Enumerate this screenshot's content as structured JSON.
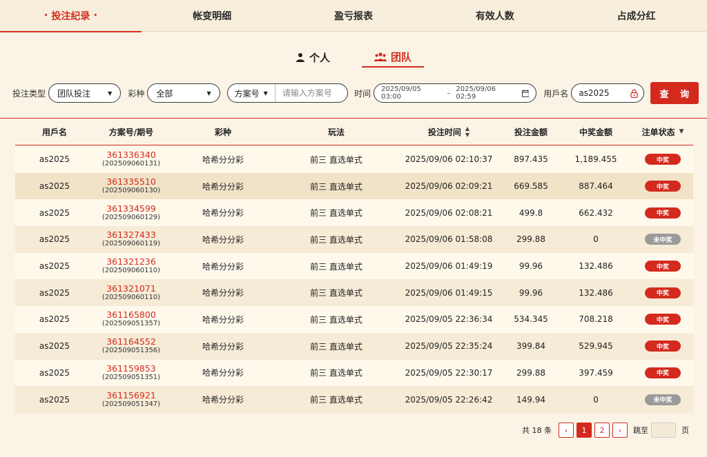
{
  "tabs": [
    "投注纪录",
    "帐变明细",
    "盈亏报表",
    "有效人数",
    "占成分红"
  ],
  "active_tab_index": 0,
  "subtabs": {
    "personal": "个人",
    "team": "团队",
    "active": "team"
  },
  "filters": {
    "bet_type_label": "投注类型",
    "bet_type_value": "团队投注",
    "lottery_label": "彩种",
    "lottery_value": "全部",
    "plan_select": "方案号",
    "plan_placeholder": "请输入方案号",
    "time_label": "时间",
    "date_start": "2025/09/05 03:00",
    "date_sep": "–",
    "date_end": "2025/09/06 02:59",
    "user_label": "用戶名",
    "user_value": "as2025",
    "query_button": "查 询"
  },
  "table": {
    "headers": [
      "用戶名",
      "方案号/期号",
      "彩种",
      "玩法",
      "投注时间",
      "投注金额",
      "中奖金额",
      "注单状态"
    ],
    "rows": [
      {
        "user": "as2025",
        "plan": "361336340",
        "issue": "(202509060131)",
        "lottery": "哈希分分彩",
        "play": "前三 直选单式",
        "time": "2025/09/06 02:10:37",
        "bet": "897.435",
        "win": "1,189.455",
        "status": "中奖",
        "won": true
      },
      {
        "user": "as2025",
        "plan": "361335510",
        "issue": "(202509060130)",
        "lottery": "哈希分分彩",
        "play": "前三 直选单式",
        "time": "2025/09/06 02:09:21",
        "bet": "669.585",
        "win": "887.464",
        "status": "中奖",
        "won": true
      },
      {
        "user": "as2025",
        "plan": "361334599",
        "issue": "(202509060129)",
        "lottery": "哈希分分彩",
        "play": "前三 直选单式",
        "time": "2025/09/06 02:08:21",
        "bet": "499.8",
        "win": "662.432",
        "status": "中奖",
        "won": true
      },
      {
        "user": "as2025",
        "plan": "361327433",
        "issue": "(202509060119)",
        "lottery": "哈希分分彩",
        "play": "前三 直选单式",
        "time": "2025/09/06 01:58:08",
        "bet": "299.88",
        "win": "0",
        "status": "未中奖",
        "won": false
      },
      {
        "user": "as2025",
        "plan": "361321236",
        "issue": "(202509060110)",
        "lottery": "哈希分分彩",
        "play": "前三 直选单式",
        "time": "2025/09/06 01:49:19",
        "bet": "99.96",
        "win": "132.486",
        "status": "中奖",
        "won": true
      },
      {
        "user": "as2025",
        "plan": "361321071",
        "issue": "(202509060110)",
        "lottery": "哈希分分彩",
        "play": "前三 直选单式",
        "time": "2025/09/06 01:49:15",
        "bet": "99.96",
        "win": "132.486",
        "status": "中奖",
        "won": true
      },
      {
        "user": "as2025",
        "plan": "361165800",
        "issue": "(202509051357)",
        "lottery": "哈希分分彩",
        "play": "前三 直选单式",
        "time": "2025/09/05 22:36:34",
        "bet": "534.345",
        "win": "708.218",
        "status": "中奖",
        "won": true
      },
      {
        "user": "as2025",
        "plan": "361164552",
        "issue": "(202509051356)",
        "lottery": "哈希分分彩",
        "play": "前三 直选单式",
        "time": "2025/09/05 22:35:24",
        "bet": "399.84",
        "win": "529.945",
        "status": "中奖",
        "won": true
      },
      {
        "user": "as2025",
        "plan": "361159853",
        "issue": "(202509051351)",
        "lottery": "哈希分分彩",
        "play": "前三 直选单式",
        "time": "2025/09/05 22:30:17",
        "bet": "299.88",
        "win": "397.459",
        "status": "中奖",
        "won": true
      },
      {
        "user": "as2025",
        "plan": "361156921",
        "issue": "(202509051347)",
        "lottery": "哈希分分彩",
        "play": "前三 直选单式",
        "time": "2025/09/05 22:26:42",
        "bet": "149.94",
        "win": "0",
        "status": "未中奖",
        "won": false
      }
    ]
  },
  "pagination": {
    "total_text": "共 18 条",
    "pages": [
      "1",
      "2"
    ],
    "current": "1",
    "prev": "‹",
    "next": "›",
    "jump_label": "跳至",
    "page_unit": "页"
  },
  "colors": {
    "accent": "#d42a1e",
    "background": "#fbf4e6",
    "lose_badge": "#9a9a9a"
  }
}
